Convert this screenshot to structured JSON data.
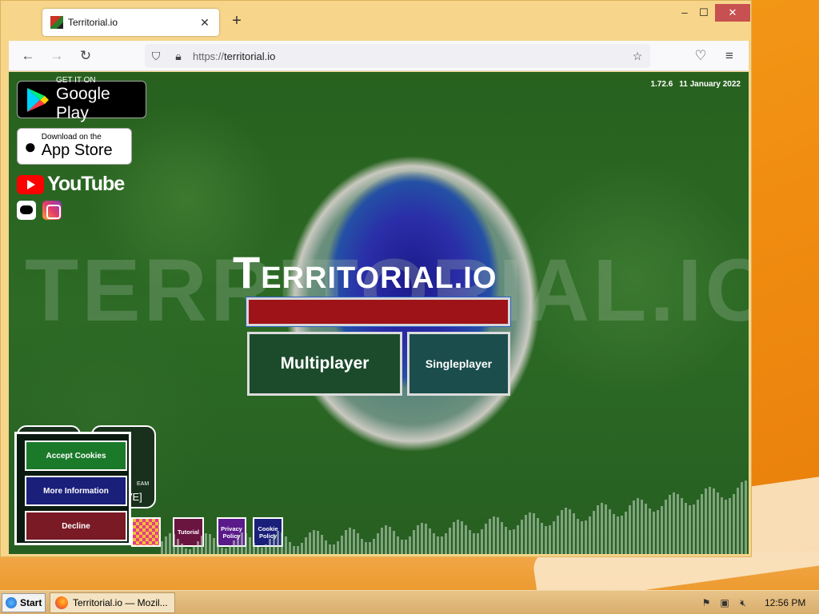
{
  "browser": {
    "tab_title": "Territorial.io",
    "tab_close": "✕",
    "new_tab": "+",
    "url_scheme": "https://",
    "url_host": "territorial.io",
    "window_min": "‒",
    "window_max": "☐",
    "window_close": "✕"
  },
  "page": {
    "version": "1.72.6",
    "date": "11 January 2022",
    "google_play": {
      "small": "GET IT ON",
      "big": "Google Play"
    },
    "app_store": {
      "small": "Download on the",
      "big": "App Store"
    },
    "youtube": "YouTube",
    "watermark": "TERRITORIAL.IO",
    "title_cap": "T",
    "title_rest": "ERRITORIAL.IO",
    "name_input_value": "",
    "multiplayer": "Multiplayer",
    "singleplayer": "Singleplayer",
    "cookie": {
      "accept": "Accept Cookies",
      "more": "More Information",
      "decline": "Decline"
    },
    "stream_label": "EAM",
    "grave_label": "[GRAVE]",
    "tutorial": "Tutorial",
    "privacy": "Privacy Policy",
    "cookie_policy": "Cookie Policy"
  },
  "taskbar": {
    "start": "Start",
    "task_title": "Territorial.io — Mozil...",
    "clock": "12:56 PM"
  },
  "colors": {
    "name_input": "#9e1318",
    "multiplayer_bg": "#1c4b2c",
    "singleplayer_bg": "#1b4d4c",
    "accept_bg": "#1a7a2a",
    "more_bg": "#1a1f7a",
    "decline_bg": "#7a1a25"
  }
}
